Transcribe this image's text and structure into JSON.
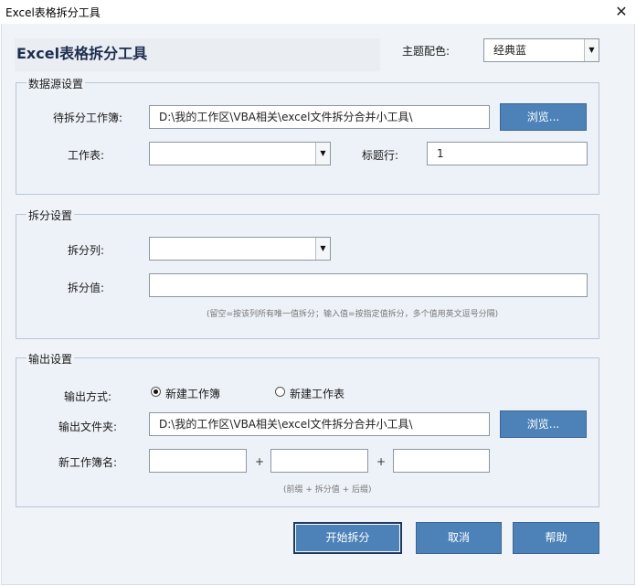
{
  "window": {
    "title": "Excel表格拆分工具",
    "close_icon": "✕"
  },
  "header": {
    "heading": "Excel表格拆分工具",
    "theme_label": "主题配色:",
    "theme_value": "经典蓝"
  },
  "source": {
    "group_title": "数据源设置",
    "workbook_label": "待拆分工作簿:",
    "workbook_path": "D:\\我的工作区\\VBA相关\\excel文件拆分合并小工具\\",
    "browse_label": "浏览...",
    "sheet_label": "工作表:",
    "sheet_value": "",
    "header_row_label": "标题行:",
    "header_row_value": "1"
  },
  "split": {
    "group_title": "拆分设置",
    "column_label": "拆分列:",
    "column_value": "",
    "value_label": "拆分值:",
    "value_value": "",
    "hint": "(留空=按该列所有唯一值拆分；输入值=按指定值拆分，多个值用英文逗号分隔)"
  },
  "output": {
    "group_title": "输出设置",
    "mode_label": "输出方式:",
    "mode_options": [
      "新建工作簿",
      "新建工作表"
    ],
    "mode_selected": "新建工作簿",
    "folder_label": "输出文件夹:",
    "folder_path": "D:\\我的工作区\\VBA相关\\excel文件拆分合并小工具\\",
    "browse_label": "浏览...",
    "name_label": "新工作簿名:",
    "prefix_value": "",
    "middle_value": "",
    "suffix_value": "",
    "plus": "+",
    "name_hint": "(前缀 + 拆分值 + 后缀)"
  },
  "actions": {
    "start_label": "开始拆分",
    "cancel_label": "取消",
    "help_label": "帮助"
  },
  "colors": {
    "button_blue": "#4d82b8",
    "group_border": "#b8c6d8",
    "heading_navy": "#1c2d4f"
  }
}
